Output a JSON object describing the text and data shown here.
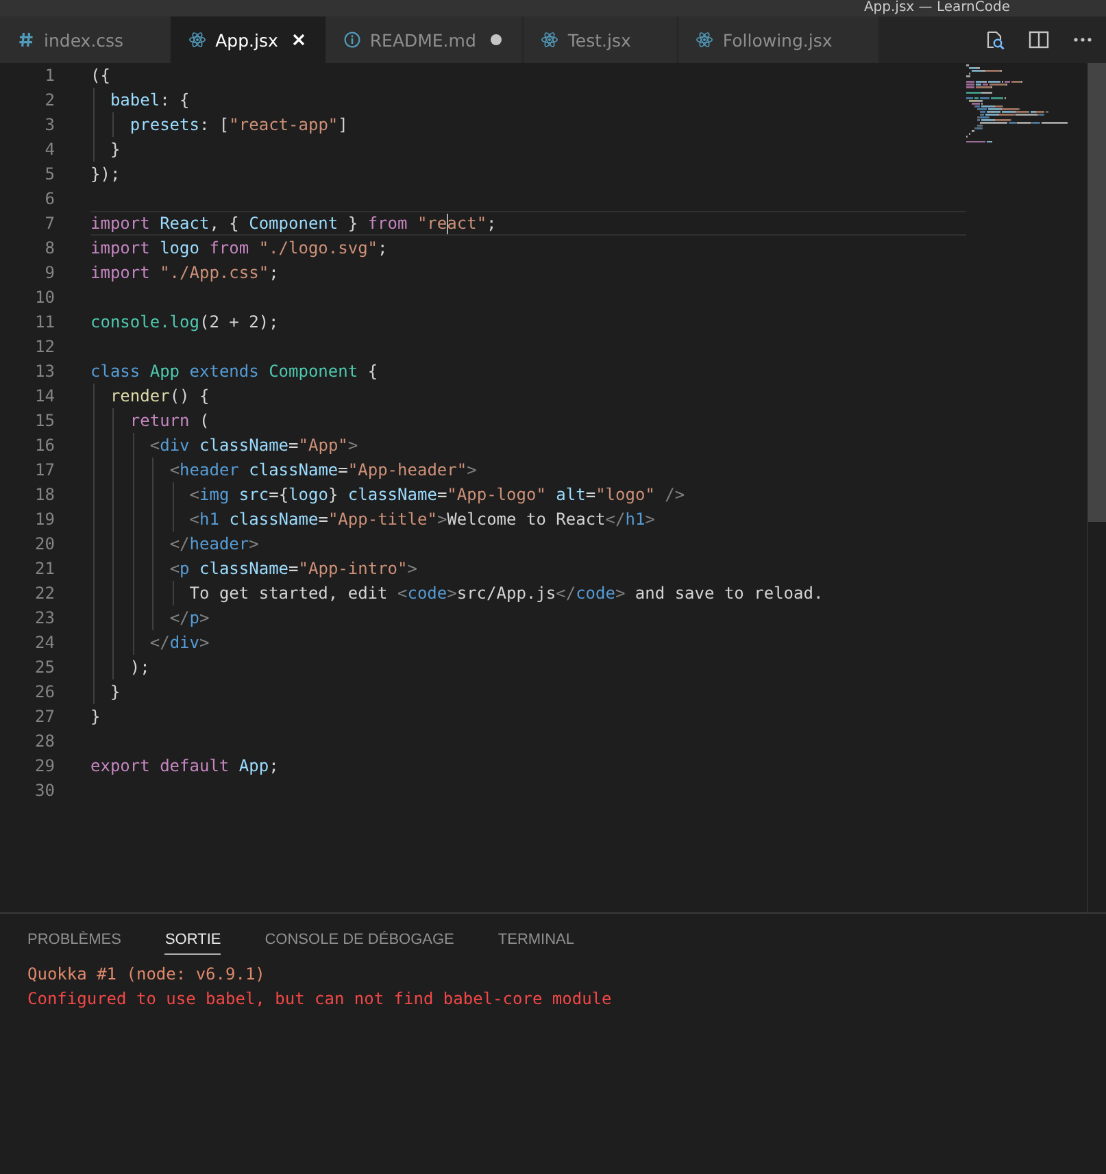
{
  "window": {
    "title": "App.jsx — LearnCode"
  },
  "tabs": [
    {
      "label": "index.css",
      "kind": "css",
      "selected": false,
      "modified": false
    },
    {
      "label": "App.jsx",
      "kind": "react",
      "selected": true,
      "modified": false
    },
    {
      "label": "README.md",
      "kind": "info",
      "selected": false,
      "modified": true
    },
    {
      "label": "Test.jsx",
      "kind": "react",
      "selected": false,
      "modified": false
    },
    {
      "label": "Following.jsx",
      "kind": "react",
      "selected": false,
      "modified": false
    }
  ],
  "editor": {
    "lines": [
      {
        "number": "1",
        "current": false,
        "tokens": [
          {
            "kind": "punctuation",
            "text": "({"
          }
        ]
      },
      {
        "number": "2",
        "current": false,
        "tokens": [
          {
            "kind": "variable",
            "text": "  babel"
          },
          {
            "kind": "punctuation",
            "text": ": {"
          }
        ]
      },
      {
        "number": "3",
        "current": false,
        "tokens": [
          {
            "kind": "variable",
            "text": "    presets"
          },
          {
            "kind": "punctuation",
            "text": ": ["
          },
          {
            "kind": "string",
            "text": "\"react-app\""
          },
          {
            "kind": "punctuation",
            "text": "]"
          }
        ]
      },
      {
        "number": "4",
        "current": false,
        "tokens": [
          {
            "kind": "punctuation",
            "text": "  }"
          }
        ]
      },
      {
        "number": "5",
        "current": false,
        "tokens": [
          {
            "kind": "punctuation",
            "text": "});"
          }
        ]
      },
      {
        "number": "6",
        "current": false
      },
      {
        "number": "7",
        "current": true,
        "tokens": [
          {
            "kind": "keyword",
            "text": "import "
          },
          {
            "kind": "variable",
            "text": "React"
          },
          {
            "kind": "punctuation",
            "text": ", { "
          },
          {
            "kind": "variable",
            "text": "Component"
          },
          {
            "kind": "punctuation",
            "text": " } "
          },
          {
            "kind": "keyword",
            "text": "from "
          },
          {
            "kind": "string",
            "text": "\"re"
          },
          {
            "kind": "cursor"
          },
          {
            "kind": "string",
            "text": "act\""
          },
          {
            "kind": "punctuation",
            "text": ";"
          }
        ]
      },
      {
        "number": "8",
        "current": false,
        "tokens": [
          {
            "kind": "keyword",
            "text": "import "
          },
          {
            "kind": "variable",
            "text": "logo "
          },
          {
            "kind": "keyword",
            "text": "from "
          },
          {
            "kind": "string",
            "text": "\"./logo.svg\""
          },
          {
            "kind": "punctuation",
            "text": ";"
          }
        ]
      },
      {
        "number": "9",
        "current": false,
        "tokens": [
          {
            "kind": "keyword",
            "text": "import "
          },
          {
            "kind": "string",
            "text": "\"./App.css\""
          },
          {
            "kind": "punctuation",
            "text": ";"
          }
        ]
      },
      {
        "number": "10",
        "current": false
      },
      {
        "number": "11",
        "current": false,
        "tokens": [
          {
            "kind": "type",
            "text": "console.log"
          },
          {
            "kind": "punctuation",
            "text": "(2 + 2);"
          }
        ]
      },
      {
        "number": "12",
        "current": false
      },
      {
        "number": "13",
        "current": false,
        "tokens": [
          {
            "kind": "storage",
            "text": "class "
          },
          {
            "kind": "type",
            "text": "App "
          },
          {
            "kind": "storage",
            "text": "extends "
          },
          {
            "kind": "type",
            "text": "Component "
          },
          {
            "kind": "punctuation",
            "text": "{"
          }
        ]
      },
      {
        "number": "14",
        "current": false,
        "tokens": [
          {
            "kind": "function",
            "text": "  render"
          },
          {
            "kind": "punctuation",
            "text": "() {"
          }
        ]
      },
      {
        "number": "15",
        "current": false,
        "tokens": [
          {
            "kind": "keyword",
            "text": "    return "
          },
          {
            "kind": "punctuation",
            "text": "("
          }
        ]
      },
      {
        "number": "16",
        "current": false,
        "tokens": [
          {
            "kind": "bracket",
            "text": "      <"
          },
          {
            "kind": "tag",
            "text": "div "
          },
          {
            "kind": "variable",
            "text": "className"
          },
          {
            "kind": "punctuation",
            "text": "="
          },
          {
            "kind": "string",
            "text": "\"App\""
          },
          {
            "kind": "bracket",
            "text": ">"
          }
        ]
      },
      {
        "number": "17",
        "current": false,
        "tokens": [
          {
            "kind": "bracket",
            "text": "        <"
          },
          {
            "kind": "tag",
            "text": "header "
          },
          {
            "kind": "variable",
            "text": "className"
          },
          {
            "kind": "punctuation",
            "text": "="
          },
          {
            "kind": "string",
            "text": "\"App-header\""
          },
          {
            "kind": "bracket",
            "text": ">"
          }
        ]
      },
      {
        "number": "18",
        "current": false,
        "tokens": [
          {
            "kind": "bracket",
            "text": "          <"
          },
          {
            "kind": "tag",
            "text": "img "
          },
          {
            "kind": "variable",
            "text": "src"
          },
          {
            "kind": "punctuation",
            "text": "={"
          },
          {
            "kind": "variable",
            "text": "logo"
          },
          {
            "kind": "punctuation",
            "text": "} "
          },
          {
            "kind": "variable",
            "text": "className"
          },
          {
            "kind": "punctuation",
            "text": "="
          },
          {
            "kind": "string",
            "text": "\"App-logo\" "
          },
          {
            "kind": "variable",
            "text": "alt"
          },
          {
            "kind": "punctuation",
            "text": "="
          },
          {
            "kind": "string",
            "text": "\"logo\" "
          },
          {
            "kind": "bracket",
            "text": "/>"
          }
        ]
      },
      {
        "number": "19",
        "current": false,
        "tokens": [
          {
            "kind": "bracket",
            "text": "          <"
          },
          {
            "kind": "tag",
            "text": "h1 "
          },
          {
            "kind": "variable",
            "text": "className"
          },
          {
            "kind": "punctuation",
            "text": "="
          },
          {
            "kind": "string",
            "text": "\"App-title\""
          },
          {
            "kind": "bracket",
            "text": ">"
          },
          {
            "kind": "text",
            "text": "Welcome to React"
          },
          {
            "kind": "bracket",
            "text": "</"
          },
          {
            "kind": "tag",
            "text": "h1"
          },
          {
            "kind": "bracket",
            "text": ">"
          }
        ]
      },
      {
        "number": "20",
        "current": false,
        "tokens": [
          {
            "kind": "bracket",
            "text": "        </"
          },
          {
            "kind": "tag",
            "text": "header"
          },
          {
            "kind": "bracket",
            "text": ">"
          }
        ]
      },
      {
        "number": "21",
        "current": false,
        "tokens": [
          {
            "kind": "bracket",
            "text": "        <"
          },
          {
            "kind": "tag",
            "text": "p "
          },
          {
            "kind": "variable",
            "text": "className"
          },
          {
            "kind": "punctuation",
            "text": "="
          },
          {
            "kind": "string",
            "text": "\"App-intro\""
          },
          {
            "kind": "bracket",
            "text": ">"
          }
        ]
      },
      {
        "number": "22",
        "current": false,
        "tokens": [
          {
            "kind": "text",
            "text": "          To get started, edit "
          },
          {
            "kind": "bracket",
            "text": "<"
          },
          {
            "kind": "tag",
            "text": "code"
          },
          {
            "kind": "bracket",
            "text": ">"
          },
          {
            "kind": "text",
            "text": "src/App.js"
          },
          {
            "kind": "bracket",
            "text": "</"
          },
          {
            "kind": "tag",
            "text": "code"
          },
          {
            "kind": "bracket",
            "text": ">"
          },
          {
            "kind": "text",
            "text": " and save to reload."
          }
        ]
      },
      {
        "number": "23",
        "current": false,
        "tokens": [
          {
            "kind": "bracket",
            "text": "        </"
          },
          {
            "kind": "tag",
            "text": "p"
          },
          {
            "kind": "bracket",
            "text": ">"
          }
        ]
      },
      {
        "number": "24",
        "current": false,
        "tokens": [
          {
            "kind": "bracket",
            "text": "      </"
          },
          {
            "kind": "tag",
            "text": "div"
          },
          {
            "kind": "bracket",
            "text": ">"
          }
        ]
      },
      {
        "number": "25",
        "current": false,
        "tokens": [
          {
            "kind": "punctuation",
            "text": "    );"
          }
        ]
      },
      {
        "number": "26",
        "current": false,
        "tokens": [
          {
            "kind": "punctuation",
            "text": "  }"
          }
        ]
      },
      {
        "number": "27",
        "current": false,
        "tokens": [
          {
            "kind": "punctuation",
            "text": "}"
          }
        ]
      },
      {
        "number": "28",
        "current": false
      },
      {
        "number": "29",
        "current": false,
        "tokens": [
          {
            "kind": "keyword",
            "text": "export default "
          },
          {
            "kind": "variable",
            "text": "App"
          },
          {
            "kind": "punctuation",
            "text": ";"
          }
        ]
      },
      {
        "number": "30",
        "current": false
      }
    ]
  },
  "panel": {
    "tabs": [
      {
        "label": "PROBLÈMES",
        "selected": false
      },
      {
        "label": "SORTIE",
        "selected": true
      },
      {
        "label": "CONSOLE DE DÉBOGAGE",
        "selected": false
      },
      {
        "label": "TERMINAL",
        "selected": false
      }
    ],
    "output": [
      {
        "kind": "info",
        "text": "Quokka #1 (node: v6.9.1)"
      },
      {
        "kind": "error",
        "text": "Configured to use babel, but can not find babel-core module"
      }
    ]
  }
}
